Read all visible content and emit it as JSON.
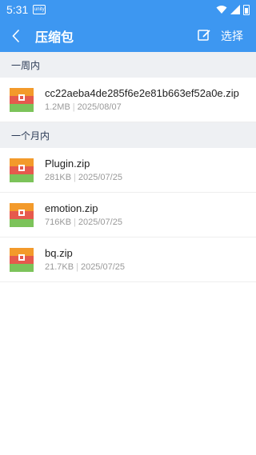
{
  "status_bar": {
    "time": "5:31",
    "notif_text": "unity"
  },
  "header": {
    "title": "压缩包",
    "select_label": "选择"
  },
  "sections": [
    {
      "title": "一周内",
      "items": [
        {
          "name": "cc22aeba4de285f6e2e81b663ef52a0e.zip",
          "size": "1.2MB",
          "date": "2025/08/07"
        }
      ]
    },
    {
      "title": "一个月内",
      "items": [
        {
          "name": "Plugin.zip",
          "size": "281KB",
          "date": "2025/07/25"
        },
        {
          "name": "emotion.zip",
          "size": "716KB",
          "date": "2025/07/25"
        },
        {
          "name": "bq.zip",
          "size": "21.7KB",
          "date": "2025/07/25"
        }
      ]
    }
  ],
  "colors": {
    "accent": "#3d97f1",
    "section_bg": "#eef0f3"
  },
  "icons": {
    "back": "back-arrow-icon",
    "edit": "edit-icon",
    "file": "archive-icon"
  }
}
